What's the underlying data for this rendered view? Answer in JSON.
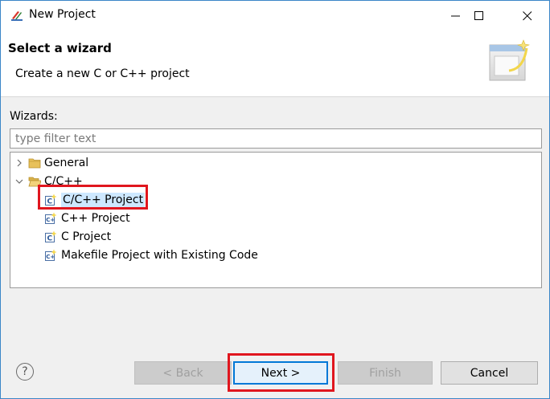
{
  "window": {
    "title": "New Project"
  },
  "banner": {
    "title": "Select a wizard",
    "description": "Create a new C or C++ project"
  },
  "wizards": {
    "label": "Wizards:",
    "filter_placeholder": "type filter text",
    "filter_value": ""
  },
  "tree": {
    "items": [
      {
        "label": "General",
        "expanded": false,
        "icon": "folder-icon"
      },
      {
        "label": "C/C++",
        "expanded": true,
        "icon": "folder-open-icon",
        "children": [
          {
            "label": "C/C++ Project",
            "selected": true,
            "icon": "c-project-icon"
          },
          {
            "label": "C++ Project",
            "selected": false,
            "icon": "cpp-project-icon"
          },
          {
            "label": "C Project",
            "selected": false,
            "icon": "c-project-icon"
          },
          {
            "label": "Makefile Project with Existing Code",
            "selected": false,
            "icon": "makefile-project-icon"
          }
        ]
      }
    ]
  },
  "buttons": {
    "back": "< Back",
    "next": "Next >",
    "finish": "Finish",
    "cancel": "Cancel",
    "help": "?"
  },
  "colors": {
    "highlight": "#e0161e",
    "selection": "#cde8ff",
    "accent": "#0078d7"
  }
}
